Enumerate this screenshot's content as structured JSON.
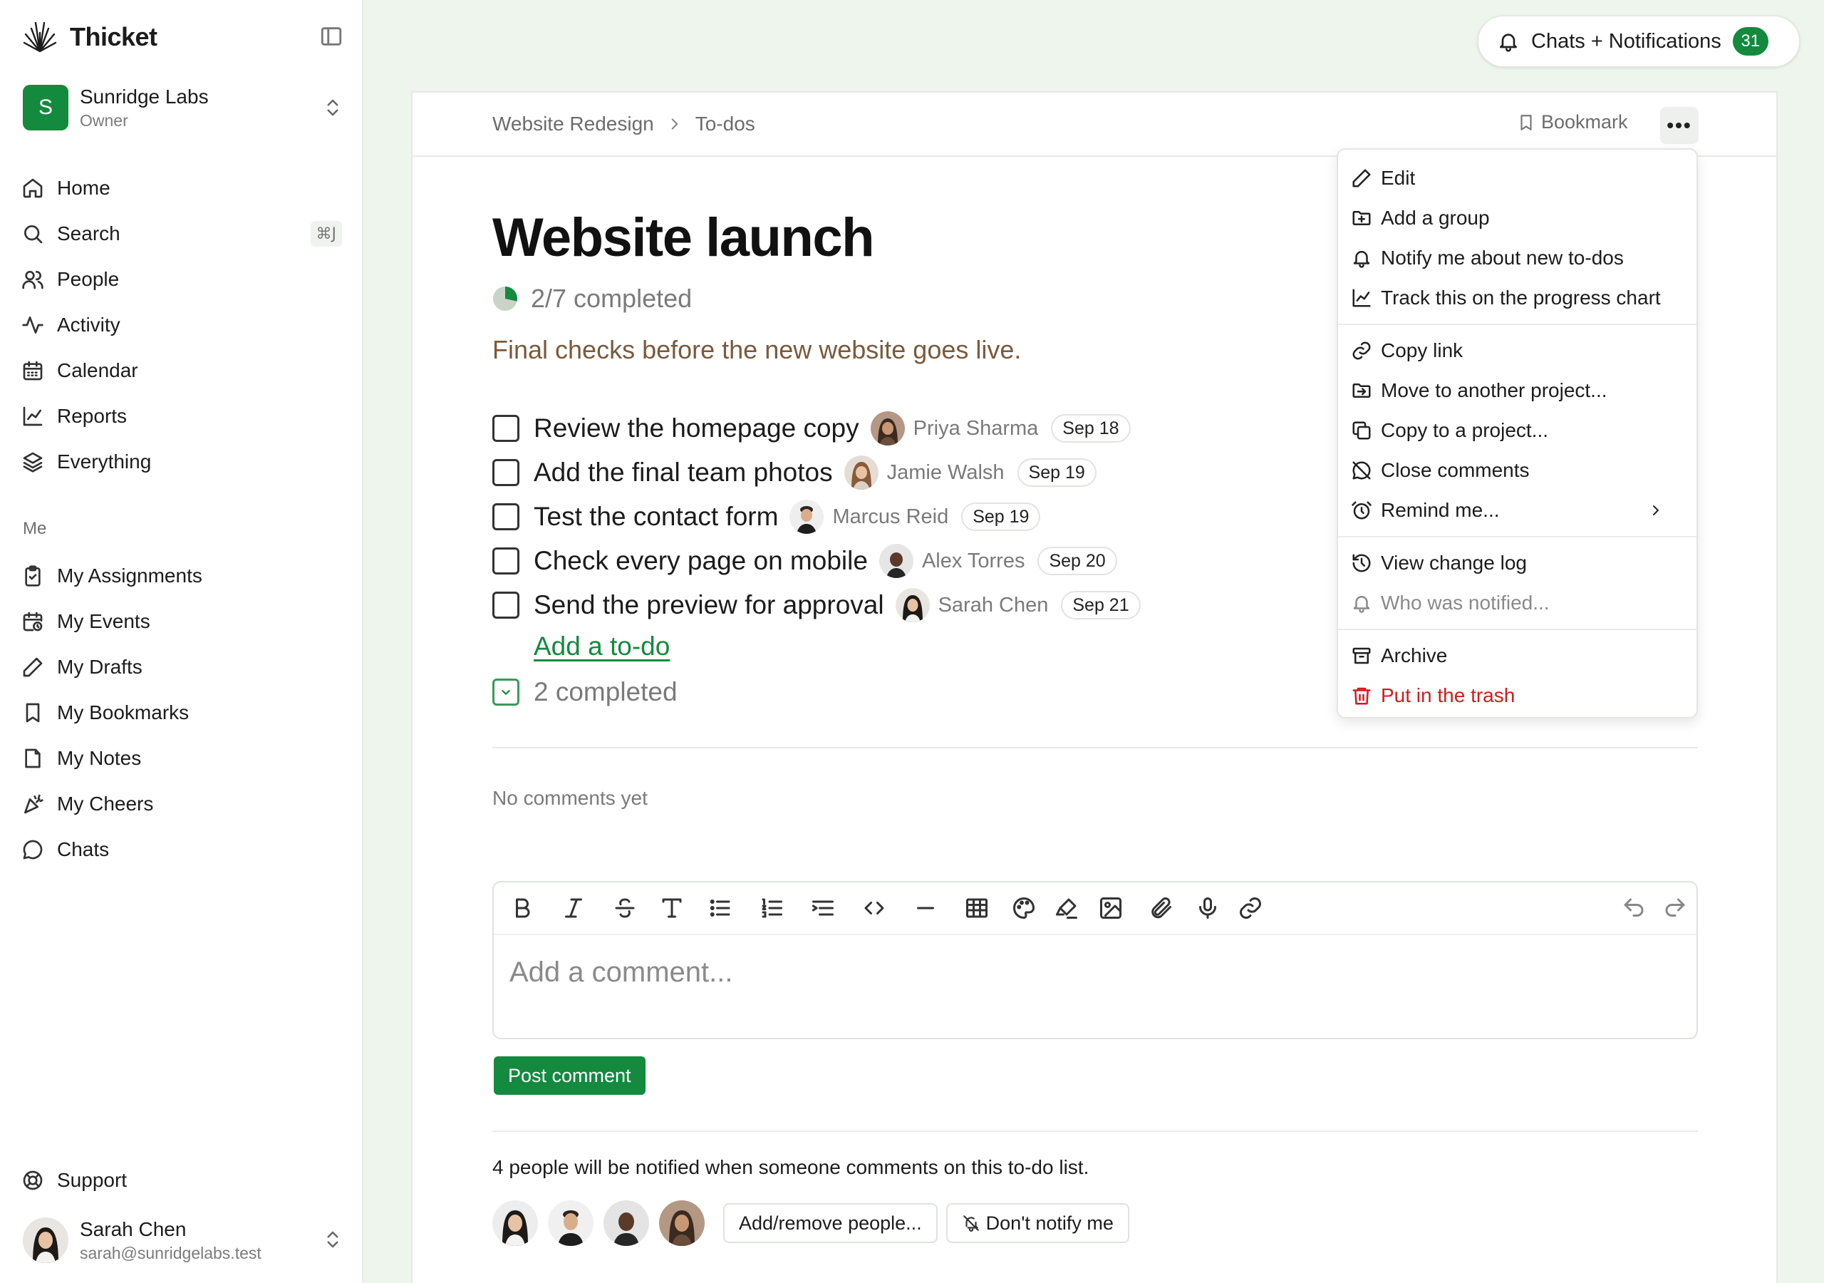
{
  "app": {
    "name": "Thicket"
  },
  "org": {
    "initial": "S",
    "name": "Sunridge Labs",
    "role": "Owner"
  },
  "nav": [
    {
      "label": "Home",
      "icon": "home-icon"
    },
    {
      "label": "Search",
      "icon": "search-icon",
      "shortcut": "⌘J"
    },
    {
      "label": "People",
      "icon": "people-icon"
    },
    {
      "label": "Activity",
      "icon": "activity-icon"
    },
    {
      "label": "Calendar",
      "icon": "calendar-icon"
    },
    {
      "label": "Reports",
      "icon": "reports-icon"
    },
    {
      "label": "Everything",
      "icon": "layers-icon"
    }
  ],
  "me_section": {
    "label": "Me",
    "items": [
      {
        "label": "My Assignments",
        "icon": "clipboard-check-icon"
      },
      {
        "label": "My Events",
        "icon": "calendar-clock-icon"
      },
      {
        "label": "My Drafts",
        "icon": "pencil-icon"
      },
      {
        "label": "My Bookmarks",
        "icon": "bookmark-icon"
      },
      {
        "label": "My Notes",
        "icon": "note-icon"
      },
      {
        "label": "My Cheers",
        "icon": "party-popper-icon"
      },
      {
        "label": "Chats",
        "icon": "chat-bubble-icon"
      }
    ]
  },
  "support": {
    "label": "Support"
  },
  "user": {
    "name": "Sarah Chen",
    "email": "sarah@sunridgelabs.test"
  },
  "header": {
    "chats_label": "Chats + Notifications",
    "chats_count": "31"
  },
  "breadcrumb": {
    "project": "Website Redesign",
    "section": "To-dos"
  },
  "bookmark_label": "Bookmark",
  "more_label": "•••",
  "list": {
    "title": "Website launch",
    "progress_text": "2/7 completed",
    "progress_fraction": 0.2857,
    "description": "Final checks before the new website goes live.",
    "todos": [
      {
        "text": "Review the homepage copy",
        "assignee": "Priya Sharma",
        "due": "Sep 18"
      },
      {
        "text": "Add the final team photos",
        "assignee": "Jamie Walsh",
        "due": "Sep 19"
      },
      {
        "text": "Test the contact form",
        "assignee": "Marcus Reid",
        "due": "Sep 19"
      },
      {
        "text": "Check every page on mobile",
        "assignee": "Alex Torres",
        "due": "Sep 20"
      },
      {
        "text": "Send the preview for approval",
        "assignee": "Sarah Chen",
        "due": "Sep 21"
      }
    ],
    "add_todo_label": "Add a to-do",
    "completed_label": "2 completed"
  },
  "comments": {
    "empty_label": "No comments yet",
    "placeholder": "Add a comment...",
    "post_label": "Post comment",
    "notify_text": "4 people will be notified when someone comments on this to-do list.",
    "add_remove_label": "Add/remove people...",
    "dont_notify_label": "Don't notify me"
  },
  "menu": {
    "items": [
      {
        "label": "Edit",
        "icon": "pencil-icon"
      },
      {
        "label": "Add a group",
        "icon": "folder-plus-icon"
      },
      {
        "label": "Notify me about new to-dos",
        "icon": "bell-icon"
      },
      {
        "label": "Track this on the progress chart",
        "icon": "chart-line-icon"
      },
      {
        "label": "Copy link",
        "icon": "link-icon"
      },
      {
        "label": "Move to another project...",
        "icon": "folder-move-icon"
      },
      {
        "label": "Copy to a project...",
        "icon": "copy-icon"
      },
      {
        "label": "Close comments",
        "icon": "comment-off-icon"
      },
      {
        "label": "Remind me...",
        "icon": "alarm-clock-icon"
      },
      {
        "label": "View change log",
        "icon": "history-icon"
      },
      {
        "label": "Who was notified...",
        "icon": "bell-icon"
      },
      {
        "label": "Archive",
        "icon": "archive-icon"
      },
      {
        "label": "Put in the trash",
        "icon": "trash-icon"
      }
    ]
  },
  "colors": {
    "accent": "#138a3e",
    "danger": "#d21c1c",
    "description": "#7a5a3c"
  }
}
